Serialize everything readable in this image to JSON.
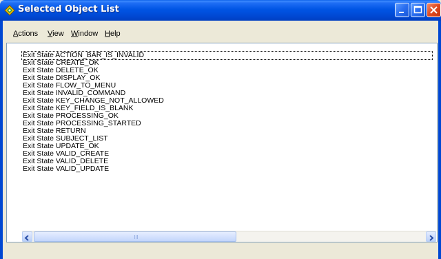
{
  "window": {
    "title": "Selected Object List",
    "icon": "application-icon"
  },
  "menubar": {
    "items": [
      "Actions",
      "View",
      "Window",
      "Help"
    ]
  },
  "list": {
    "items": [
      "Exit State ACTION_BAR_IS_INVALID",
      "Exit State CREATE_OK",
      "Exit State DELETE_OK",
      "Exit State DISPLAY_OK",
      "Exit State FLOW_TO_MENU",
      "Exit State INVALID_COMMAND",
      "Exit State KEY_CHANGE_NOT_ALLOWED",
      "Exit State KEY_FIELD_IS_BLANK",
      "Exit State PROCESSING_OK",
      "Exit State PROCESSING_STARTED",
      "Exit State RETURN",
      "Exit State SUBJECT_LIST",
      "Exit State UPDATE_OK",
      "Exit State VALID_CREATE",
      "Exit State VALID_DELETE",
      "Exit State VALID_UPDATE"
    ]
  },
  "colors": {
    "titlebar": "#0055e5",
    "close_button": "#e04a20",
    "window_face": "#ece9d8"
  }
}
